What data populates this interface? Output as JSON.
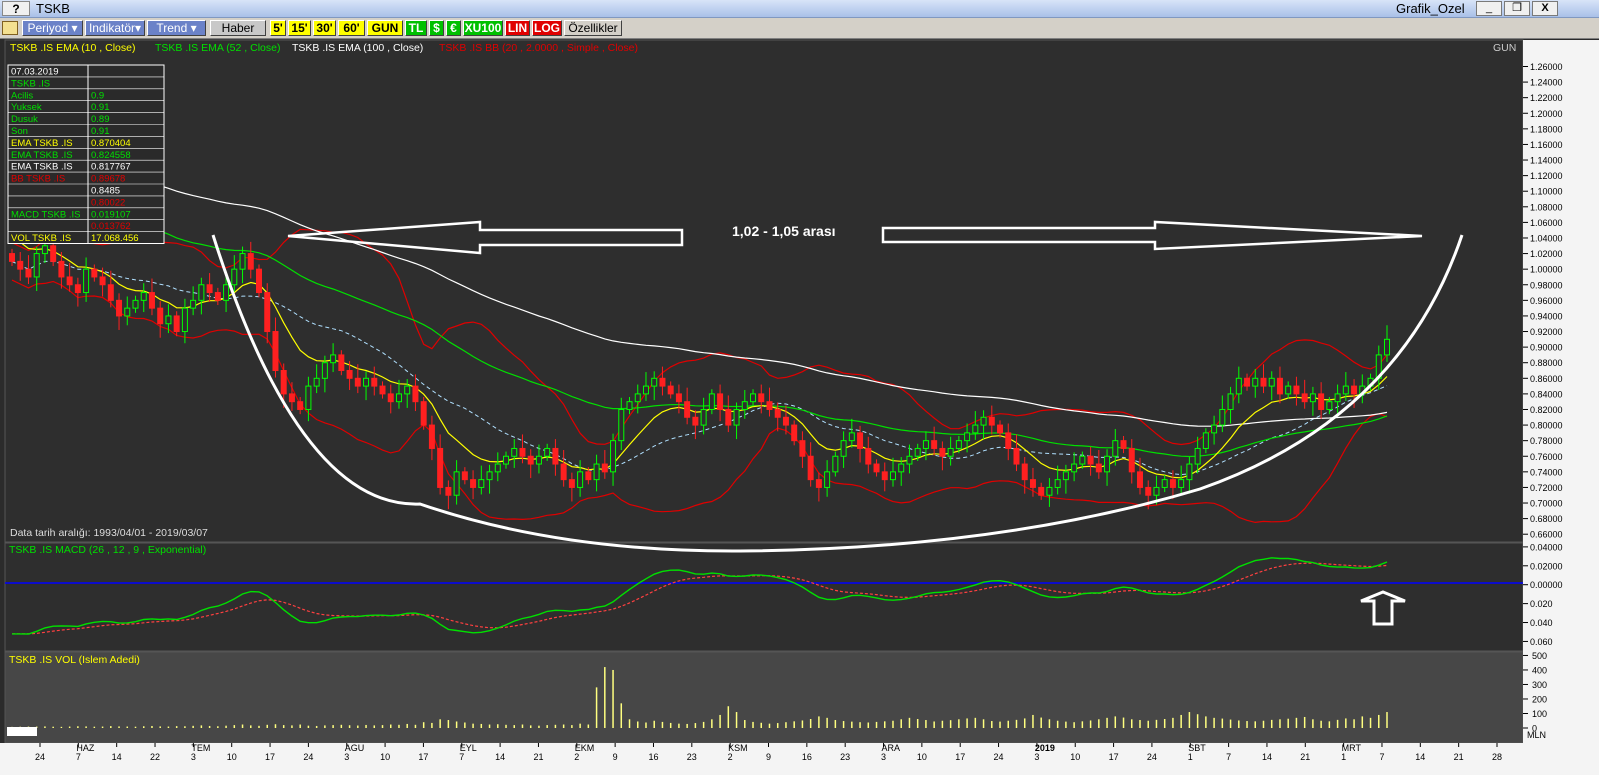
{
  "window": {
    "help_label": "?",
    "title": "TSKB",
    "panel_name": "Grafik_Ozel",
    "minimize": "_",
    "restore": "❐",
    "close": "X"
  },
  "toolbar": {
    "menus": [
      "Periyod",
      "Indikatör",
      "Trend"
    ],
    "haber": "Haber",
    "periods": [
      "5'",
      "15'",
      "30'",
      "60'",
      "GUN"
    ],
    "currency": [
      "TL",
      "$",
      "€"
    ],
    "index": "XU100",
    "scale": [
      "LIN",
      "LOG"
    ],
    "ozellikler": "Özellikler"
  },
  "chart_data": {
    "type": "candlestick",
    "symbol": "TSKB .IS",
    "period_label": "GUN",
    "legend": [
      {
        "text": "TSKB .IS EMA (10 , Close)",
        "color": "#ffff00"
      },
      {
        "text": "TSKB .IS EMA (52 , Close)",
        "color": "#00e000"
      },
      {
        "text": "TSKB .IS EMA (100 , Close)",
        "color": "#ffffff"
      },
      {
        "text": "TSKB .IS BB (20 , 2.0000 , Simple , Close)",
        "color": "#e00000"
      }
    ],
    "date_range_text": "Data tarih aralığı: 1993/04/01 - 2019/03/07",
    "ylim": [
      0.65,
      1.285
    ],
    "y_ticks": [
      0.66,
      0.68,
      0.7,
      0.72,
      0.74,
      0.76,
      0.78,
      0.8,
      0.82,
      0.84,
      0.86,
      0.88,
      0.9,
      0.92,
      0.94,
      0.96,
      0.98,
      1.0,
      1.02,
      1.04,
      1.06,
      1.08,
      1.1,
      1.12,
      1.14,
      1.16,
      1.18,
      1.2,
      1.22,
      1.24,
      1.26
    ],
    "y_tick_labels": [
      "0.66000",
      "0.68000",
      "0.70000",
      "0.72000",
      "0.74000",
      "0.76000",
      "0.78000",
      "0.80000",
      "0.82000",
      "0.84000",
      "0.86000",
      "0.88000",
      "0.90000",
      "0.92000",
      "0.94000",
      "0.96000",
      "0.98000",
      "1.00000",
      "1.02000",
      "1.04000",
      "1.06000",
      "1.08000",
      "1.10000",
      "1.12000",
      "1.14000",
      "1.16000",
      "1.18000",
      "1.20000",
      "1.22000",
      "1.24000",
      "1.26000"
    ],
    "close": [
      1.01,
      1.0,
      0.99,
      1.02,
      1.03,
      1.01,
      0.99,
      0.98,
      0.97,
      1.0,
      0.99,
      0.98,
      0.96,
      0.94,
      0.95,
      0.96,
      0.97,
      0.95,
      0.93,
      0.94,
      0.92,
      0.95,
      0.96,
      0.98,
      0.97,
      0.96,
      0.98,
      1.0,
      1.02,
      1.0,
      0.97,
      0.92,
      0.87,
      0.84,
      0.83,
      0.82,
      0.85,
      0.86,
      0.88,
      0.89,
      0.87,
      0.86,
      0.85,
      0.86,
      0.85,
      0.84,
      0.83,
      0.84,
      0.85,
      0.83,
      0.8,
      0.77,
      0.72,
      0.71,
      0.74,
      0.73,
      0.72,
      0.73,
      0.74,
      0.75,
      0.76,
      0.77,
      0.76,
      0.75,
      0.76,
      0.77,
      0.75,
      0.73,
      0.72,
      0.74,
      0.73,
      0.75,
      0.74,
      0.78,
      0.82,
      0.83,
      0.84,
      0.85,
      0.86,
      0.85,
      0.84,
      0.83,
      0.81,
      0.8,
      0.82,
      0.84,
      0.82,
      0.8,
      0.82,
      0.83,
      0.84,
      0.83,
      0.82,
      0.81,
      0.8,
      0.78,
      0.76,
      0.73,
      0.72,
      0.74,
      0.76,
      0.78,
      0.79,
      0.77,
      0.75,
      0.74,
      0.73,
      0.74,
      0.75,
      0.76,
      0.77,
      0.78,
      0.77,
      0.76,
      0.77,
      0.78,
      0.79,
      0.8,
      0.81,
      0.8,
      0.79,
      0.77,
      0.75,
      0.73,
      0.72,
      0.71,
      0.72,
      0.73,
      0.74,
      0.75,
      0.76,
      0.75,
      0.74,
      0.76,
      0.78,
      0.77,
      0.74,
      0.72,
      0.71,
      0.72,
      0.73,
      0.72,
      0.73,
      0.75,
      0.77,
      0.79,
      0.8,
      0.82,
      0.84,
      0.86,
      0.85,
      0.86,
      0.85,
      0.86,
      0.84,
      0.85,
      0.84,
      0.83,
      0.84,
      0.82,
      0.83,
      0.84,
      0.85,
      0.84,
      0.85,
      0.86,
      0.89,
      0.91
    ],
    "annotation_text": "1,02 - 1,05 arası",
    "data_panel": {
      "rows": [
        [
          "07.03.2019",
          ""
        ],
        [
          "TSKB .IS",
          ""
        ],
        [
          "Acilis",
          "0.9"
        ],
        [
          "Yuksek",
          "0.91"
        ],
        [
          "Dusuk",
          "0.89"
        ],
        [
          "Son",
          "0.91"
        ],
        [
          "EMA TSKB .IS",
          "0.870404"
        ],
        [
          "EMA TSKB .IS",
          "0.824558"
        ],
        [
          "EMA TSKB .IS",
          "0.817767"
        ],
        [
          "BB TSKB .IS",
          "0.89678"
        ],
        [
          "",
          "0.8485"
        ],
        [
          "",
          "0.80022"
        ],
        [
          "MACD TSKB .IS",
          "0.019107"
        ],
        [
          "",
          "0.013762"
        ],
        [
          "VOL TSKB .IS",
          "17.068.456"
        ]
      ],
      "row_colors": [
        "#ffffff",
        "#00e000",
        "#00e000",
        "#00e000",
        "#00e000",
        "#00e000",
        "#ffff00",
        "#00e000",
        "#ffffff",
        "#e00000",
        "#ffffff",
        "#e00000",
        "#00e000",
        "#e00000",
        "#ffff00"
      ]
    },
    "macd": {
      "title": "TSKB .IS MACD (26 , 12 , 9 , Exponential)",
      "ylim": [
        -0.068,
        0.042
      ],
      "y_ticks": [
        0.04,
        0.02,
        0.0,
        -0.02,
        -0.04,
        -0.06
      ],
      "y_tick_labels": [
        "0.04000",
        "0.02000",
        "0.00000",
        "0.020",
        "0.040",
        "0.060"
      ]
    },
    "volume": {
      "title": "TSKB .IS VOL (Islem Adedi)",
      "ylim": [
        0,
        510
      ],
      "y_ticks": [
        0,
        100,
        200,
        300,
        400,
        500
      ],
      "y_tick_labels": [
        "0",
        "100",
        "200",
        "300",
        "400",
        "500"
      ],
      "unit_label": "MLN",
      "values": [
        8,
        9,
        10,
        10,
        11,
        9,
        8,
        10,
        12,
        11,
        9,
        10,
        13,
        11,
        10,
        9,
        12,
        14,
        11,
        10,
        13,
        12,
        15,
        18,
        14,
        12,
        16,
        20,
        24,
        18,
        15,
        22,
        26,
        20,
        18,
        24,
        16,
        14,
        18,
        20,
        22,
        19,
        17,
        21,
        18,
        20,
        24,
        22,
        28,
        22,
        40,
        35,
        60,
        55,
        45,
        38,
        30,
        28,
        24,
        26,
        22,
        20,
        24,
        18,
        16,
        20,
        22,
        24,
        20,
        30,
        24,
        280,
        420,
        400,
        170,
        60,
        45,
        38,
        50,
        42,
        35,
        30,
        28,
        34,
        42,
        60,
        90,
        150,
        110,
        55,
        42,
        36,
        30,
        34,
        40,
        46,
        52,
        62,
        80,
        70,
        55,
        48,
        44,
        40,
        38,
        42,
        46,
        50,
        60,
        70,
        62,
        55,
        45,
        50,
        54,
        60,
        66,
        70,
        60,
        48,
        44,
        50,
        56,
        66,
        90,
        72,
        60,
        50,
        44,
        40,
        46,
        52,
        60,
        70,
        80,
        72,
        60,
        55,
        50,
        56,
        62,
        70,
        90,
        110,
        95,
        80,
        70,
        65,
        58,
        52,
        48,
        46,
        50,
        56,
        60,
        64,
        70,
        76,
        60,
        50,
        46,
        56,
        66,
        60,
        80,
        70,
        90,
        110,
        100,
        88
      ]
    },
    "date_ticks": [
      {
        "major": "",
        "minor": "24"
      },
      {
        "major": "HAZ",
        "minor": "7"
      },
      {
        "major": "",
        "minor": "14"
      },
      {
        "major": "",
        "minor": "22"
      },
      {
        "major": "TEM",
        "minor": "3"
      },
      {
        "major": "",
        "minor": "10"
      },
      {
        "major": "",
        "minor": "17"
      },
      {
        "major": "",
        "minor": "24"
      },
      {
        "major": "AGU",
        "minor": "3"
      },
      {
        "major": "",
        "minor": "10"
      },
      {
        "major": "",
        "minor": "17"
      },
      {
        "major": "EYL",
        "minor": "7"
      },
      {
        "major": "",
        "minor": "14"
      },
      {
        "major": "",
        "minor": "21"
      },
      {
        "major": "EKM",
        "minor": "2"
      },
      {
        "major": "",
        "minor": "9"
      },
      {
        "major": "",
        "minor": "16"
      },
      {
        "major": "",
        "minor": "23"
      },
      {
        "major": "KSM",
        "minor": "2"
      },
      {
        "major": "",
        "minor": "9"
      },
      {
        "major": "",
        "minor": "16"
      },
      {
        "major": "",
        "minor": "23"
      },
      {
        "major": "ARA",
        "minor": "3"
      },
      {
        "major": "",
        "minor": "10"
      },
      {
        "major": "",
        "minor": "17"
      },
      {
        "major": "",
        "minor": "24"
      },
      {
        "major": "2019",
        "minor": "3"
      },
      {
        "major": "",
        "minor": "10"
      },
      {
        "major": "",
        "minor": "17"
      },
      {
        "major": "",
        "minor": "24"
      },
      {
        "major": "SBT",
        "minor": "1"
      },
      {
        "major": "",
        "minor": "7"
      },
      {
        "major": "",
        "minor": "14"
      },
      {
        "major": "",
        "minor": "21"
      },
      {
        "major": "MRT",
        "minor": "1"
      },
      {
        "major": "",
        "minor": "7"
      },
      {
        "major": "",
        "minor": "14"
      },
      {
        "major": "",
        "minor": "21"
      },
      {
        "major": "",
        "minor": "28"
      }
    ],
    "colors": {
      "up": "#00ff00",
      "down": "#ff2020",
      "ema10": "#ffff00",
      "ema52": "#00e000",
      "ema100": "#ffffff",
      "bb": "#e00000",
      "macd": "#00e000",
      "signal": "#ff4040",
      "zero": "#0000ff",
      "volume": "#ffff80"
    }
  }
}
